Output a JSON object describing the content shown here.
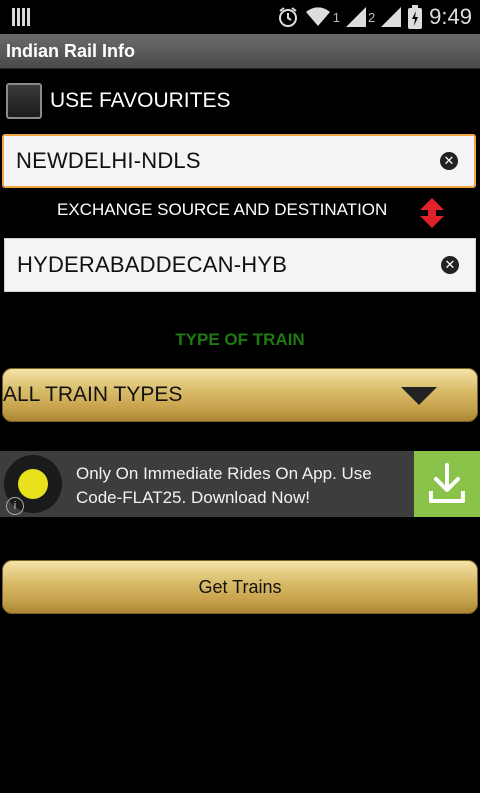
{
  "status_bar": {
    "time": "9:49",
    "sim1": "1",
    "sim2": "2",
    "icons": [
      "notification-icon",
      "alarm-icon",
      "wifi-icon",
      "signal-icon",
      "battery-icon"
    ]
  },
  "app": {
    "title": "Indian Rail Info"
  },
  "favourites": {
    "label": "USE FAVOURITES",
    "checked": false
  },
  "source": {
    "value": "NEWDELHI-NDLS",
    "focused": true
  },
  "exchange": {
    "label": "EXCHANGE SOURCE AND DESTINATION"
  },
  "destination": {
    "value": "HYDERABADDECAN-HYB"
  },
  "train_type": {
    "label": "TYPE OF TRAIN",
    "selected": "ALL TRAIN TYPES"
  },
  "ad": {
    "text": "Only On Immediate Rides On App. Use Code-FLAT25. Download Now!",
    "info_icon": "i"
  },
  "actions": {
    "get_trains": "Get Trains"
  },
  "colors": {
    "accent_orange": "#f2a445",
    "type_label_green": "#1f7a12",
    "exchange_red": "#e0202a",
    "download_green": "#8bc34a",
    "ad_logo_yellow": "#e8e11c"
  }
}
